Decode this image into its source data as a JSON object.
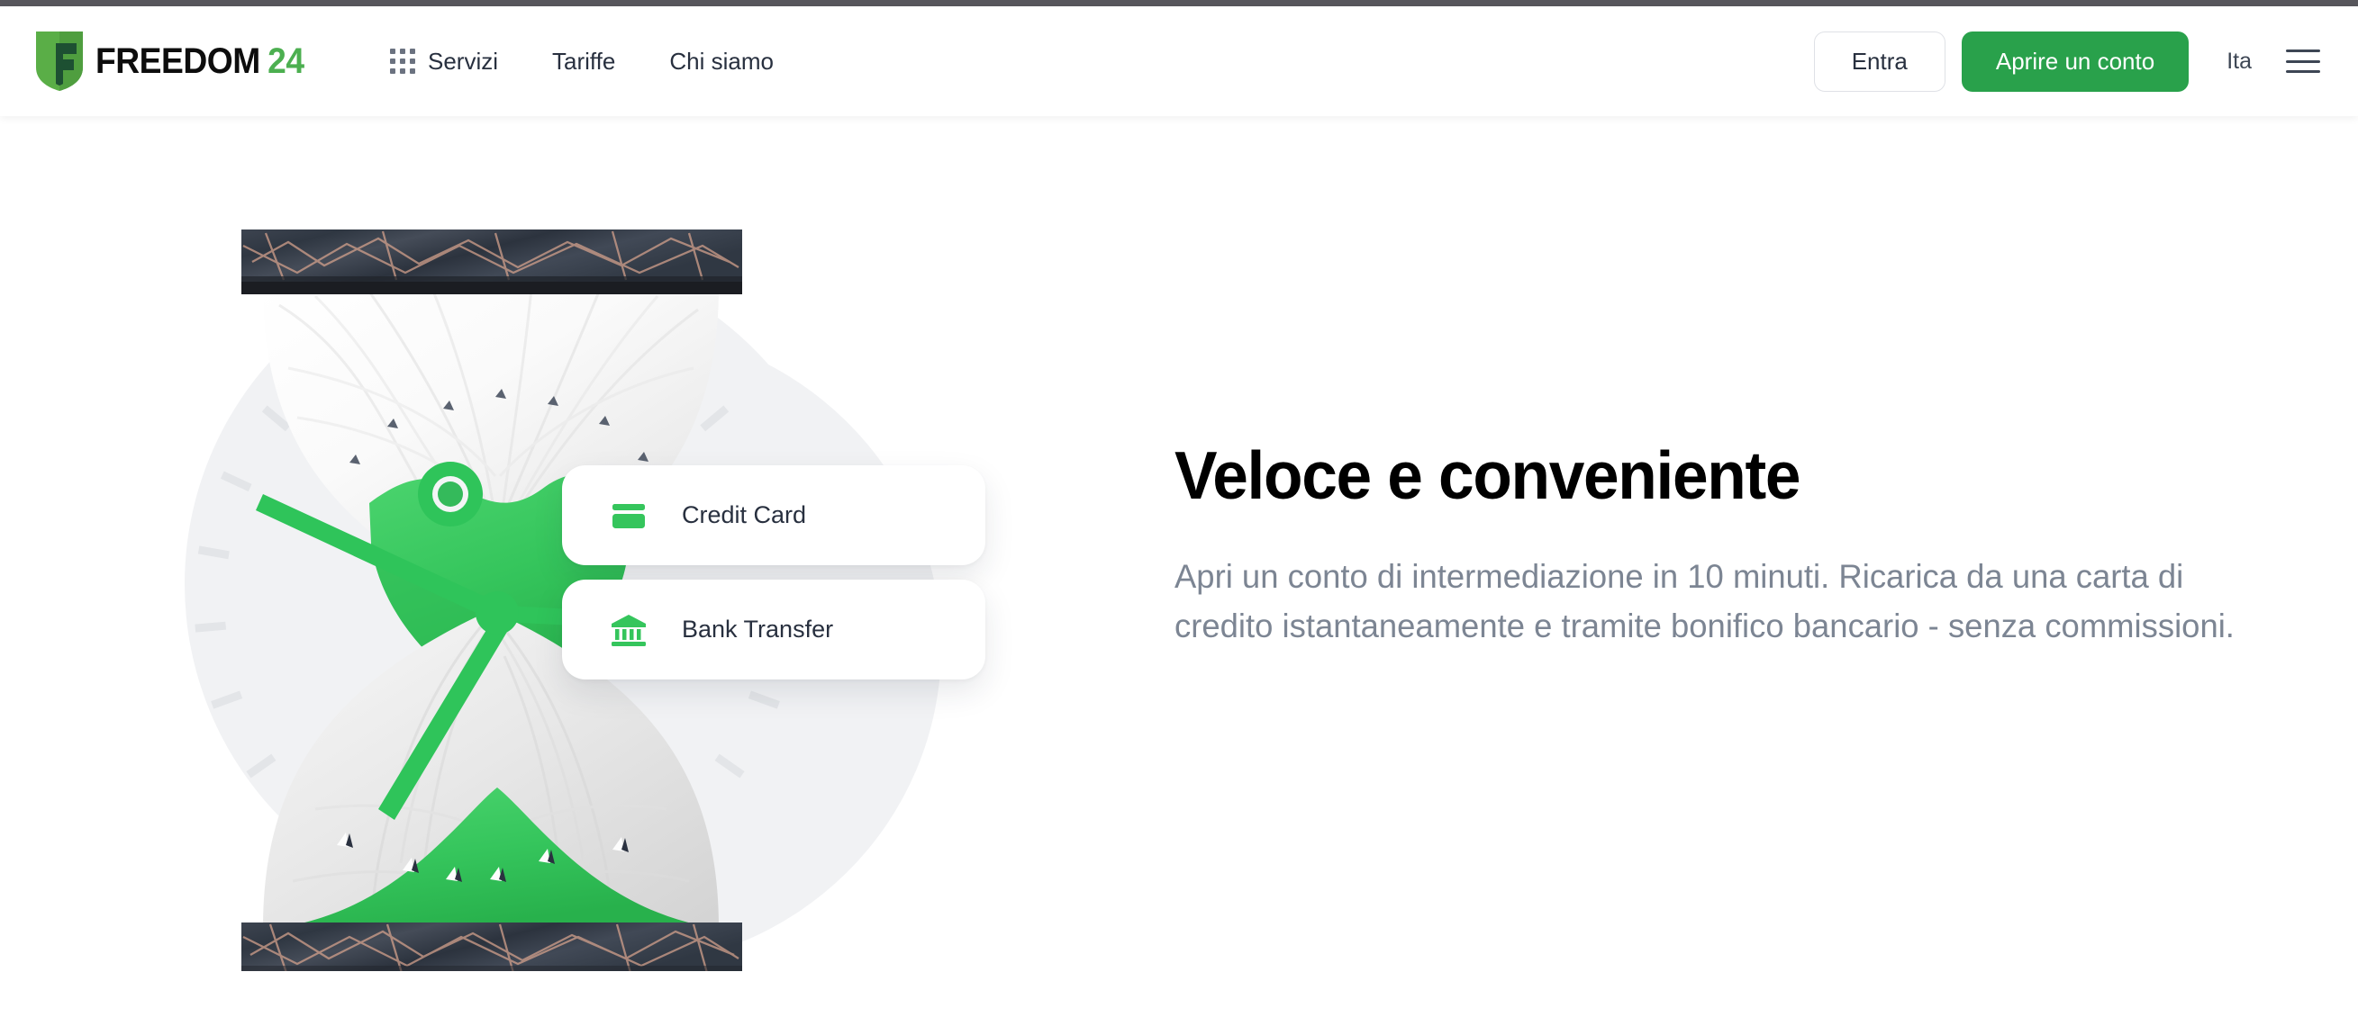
{
  "brand": {
    "accent_green": "#29a14b",
    "logo_green": "#4caf50",
    "shield_dark_green": "#1d5032",
    "text_dark": "#28303f",
    "muted_text": "#7c8593",
    "illustration_bg": "#f1f2f4",
    "logo_name": "FREEDOM",
    "logo_suffix": "24",
    "shield_icon": "freedom-shield-icon"
  },
  "header": {
    "grid_icon": "apps-grid-icon",
    "nav": [
      {
        "label": "Servizi",
        "icon": "apps-grid-icon"
      },
      {
        "label": "Tariffe",
        "icon": ""
      },
      {
        "label": "Chi siamo",
        "icon": ""
      }
    ],
    "login_label": "Entra",
    "open_account_label": "Aprire un conto",
    "language": "Ita",
    "menu_icon": "hamburger-menu-icon"
  },
  "hero": {
    "headline": "Veloce e conveniente",
    "paragraph": "Apri un conto di intermediazione in 10 minuti. Ricarica da una carta di credito istantaneamente e tramite bonifico bancario - senza commissioni.",
    "illustration": "hourglass-clock-illustration",
    "payment_methods": [
      {
        "label": "Credit Card",
        "icon": "credit-card-icon"
      },
      {
        "label": "Bank Transfer",
        "icon": "bank-building-icon"
      }
    ]
  }
}
